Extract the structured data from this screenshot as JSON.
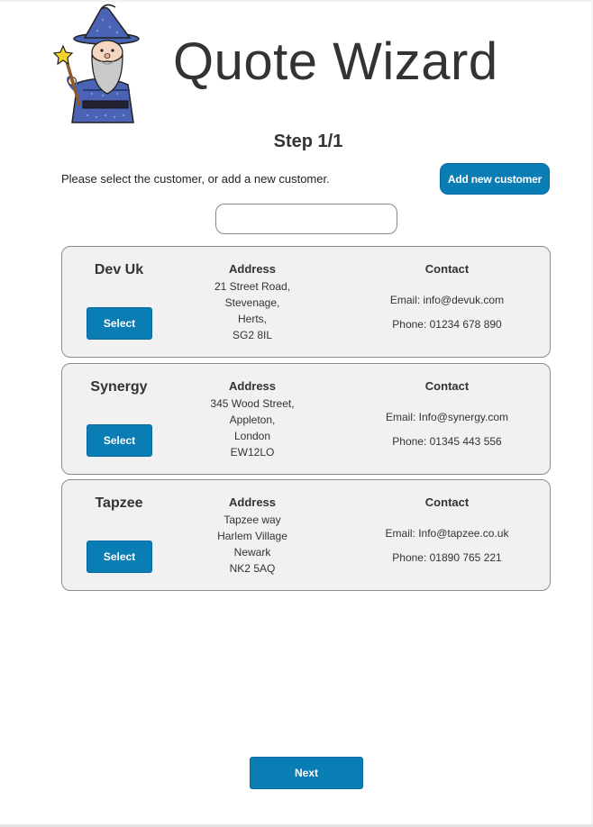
{
  "app": {
    "title": "Quote Wizard",
    "logo_icon": "wizard-mascot-icon"
  },
  "step": {
    "title": "Step 1/1",
    "instructions": "Please select the customer, or add a new customer.",
    "add_button_label": "Add new customer"
  },
  "search": {
    "value": "",
    "placeholder": ""
  },
  "labels": {
    "address_heading": "Address",
    "contact_heading": "Contact",
    "select_label": "Select"
  },
  "customers": [
    {
      "name": "Dev Uk",
      "address": [
        "21 Street Road,",
        "Stevenage,",
        "Herts,",
        "SG2 8IL"
      ],
      "email": "Email: info@devuk.com",
      "phone": "Phone: 01234 678 890"
    },
    {
      "name": "Synergy",
      "address": [
        "345 Wood Street,",
        "Appleton,",
        "London",
        "EW12LO"
      ],
      "email": "Email: Info@synergy.com",
      "phone": "Phone: 01345 443 556"
    },
    {
      "name": "Tapzee",
      "address": [
        "Tapzee way",
        "Harlem Village",
        "Newark",
        "NK2 5AQ"
      ],
      "email": "Email: Info@tapzee.co.uk",
      "phone": "Phone: 01890 765 221"
    }
  ],
  "footer": {
    "next_label": "Next"
  },
  "colors": {
    "primary_button": "#0a7db5",
    "card_background": "#f1f1f1",
    "text": "#333333"
  }
}
